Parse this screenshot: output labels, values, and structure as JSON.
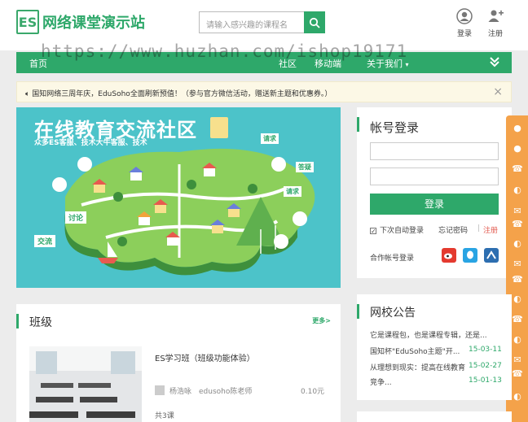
{
  "header": {
    "logo_mark": "ES",
    "site_name": "网络课堂演示站",
    "search_placeholder": "请输入感兴趣的课程名",
    "login_label": "登录",
    "register_label": "注册"
  },
  "nav": {
    "items": [
      {
        "label": "首页"
      },
      {
        "label": "社区"
      },
      {
        "label": "移动端"
      },
      {
        "label": "关于我们"
      }
    ]
  },
  "watermark": "https://www.huzhan.com/ishop19171",
  "notice": {
    "text": "国知网络三周年庆，EduSoho全面刷新预值！（参与官方微信活动，赠送新主题和优惠券。）"
  },
  "banner": {
    "title": "在线教育交流社区",
    "subtitle": "众多ES客服、技术大牛客服、技术",
    "labels": [
      "请求",
      "讨论",
      "交流",
      "答疑",
      "请求"
    ]
  },
  "login": {
    "title": "帐号登录",
    "button": "登录",
    "remember": "下次自动登录",
    "forgot": "忘记密码",
    "separator": "|",
    "register": "注册",
    "social_label": "合作帐号登录"
  },
  "classes": {
    "title": "班级",
    "more": "更多>",
    "item": {
      "name": "ES学习班（班级功能体验）",
      "teacher": "杨浩咏　edusoho陈老师",
      "price": "0.10元",
      "count": "共3课"
    }
  },
  "announcements": {
    "title": "网校公告",
    "items": [
      {
        "text": "它是课程包，也是课程专辑，还是...",
        "date": ""
      },
      {
        "text": "国知杯\"EduSoho主题\"开...",
        "date": "15-03-11"
      },
      {
        "text": "从理想到现实：提高在线教育",
        "date": "15-02-27"
      },
      {
        "text": "竞争...",
        "date": "15-01-13"
      }
    ]
  },
  "colors": {
    "brand": "#2ea86a",
    "float_bar": "#f4a24a",
    "banner_bg": "#4cc3c9"
  }
}
